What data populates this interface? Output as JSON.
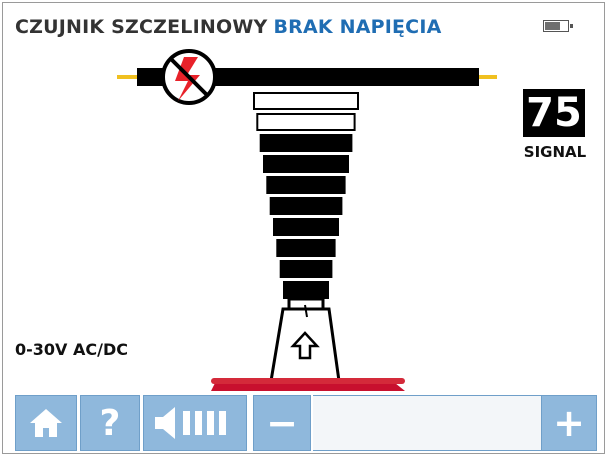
{
  "header": {
    "title": "CZUJNIK SZCZELINOWY",
    "status": "BRAK NAPIĘCIA",
    "status_color": "#1f6db3"
  },
  "battery": {
    "level": 0.7,
    "icon": "battery-icon"
  },
  "signal": {
    "value": "75",
    "label": "SIGNAL"
  },
  "range": {
    "label": "0-30V AC/DC"
  },
  "indicator": {
    "icon": "no-voltage-icon",
    "cable_color": "#000000",
    "cable_tip_color": "#f0c020",
    "bars_total": 10,
    "bars_filled": 8
  },
  "probe": {
    "icon": "arrow-up-icon",
    "base_color": "#c8102e"
  },
  "toolbar": {
    "home_icon": "home-icon",
    "help_label": "?",
    "volume_icon": "volume-icon",
    "minus_label": "−",
    "plus_label": "+",
    "level": 0.0,
    "button_color": "#8fb8dc"
  }
}
